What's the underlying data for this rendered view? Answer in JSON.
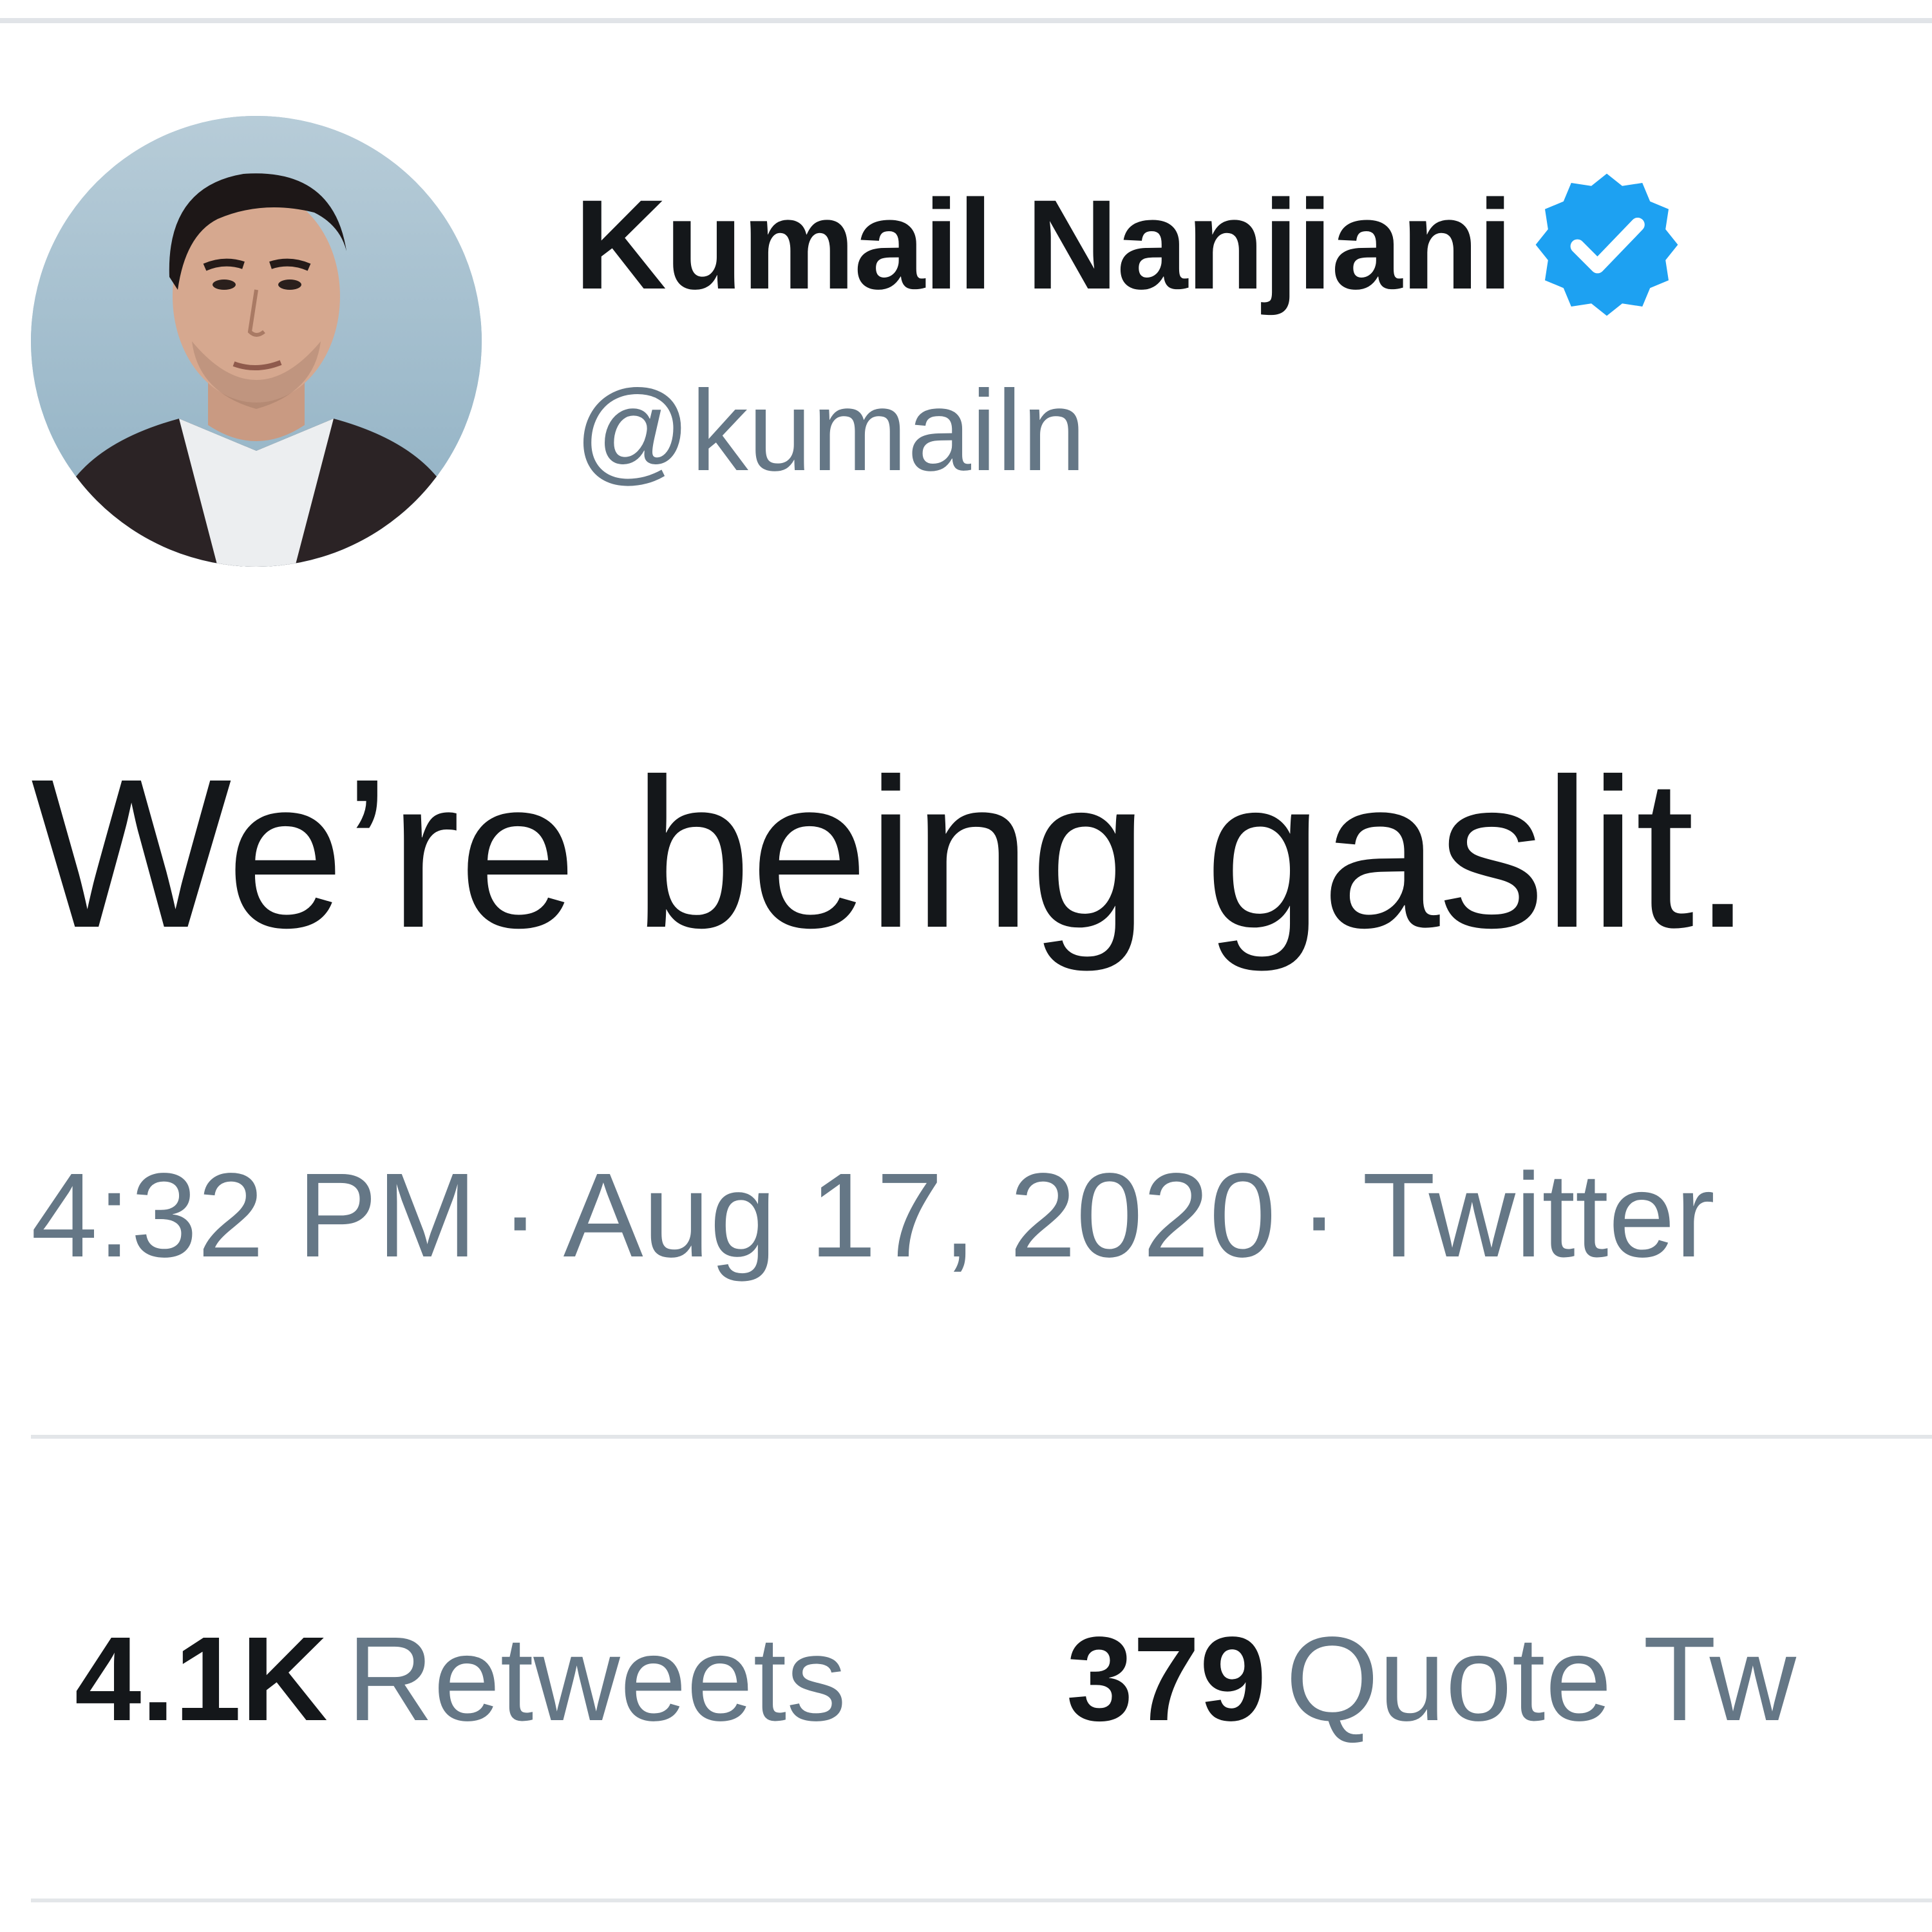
{
  "tweet": {
    "author": {
      "display_name": "Kumail Nanjiani",
      "handle": "@kumailn",
      "verified": true,
      "verified_icon": "verified-badge-icon",
      "verified_color": "#1da1f2"
    },
    "text": "We’re being gaslit.",
    "timestamp": {
      "time": "4:32 PM",
      "separator": "·",
      "date": "Aug 17, 2020",
      "source": "Twitter"
    },
    "stats": [
      {
        "count": "4.1K",
        "label": "Retweets"
      },
      {
        "count": "379",
        "label": "Quote Tw"
      }
    ]
  },
  "colors": {
    "text_primary": "#14171a",
    "text_secondary": "#657786",
    "divider": "#e1e4e8",
    "background": "#ffffff"
  }
}
